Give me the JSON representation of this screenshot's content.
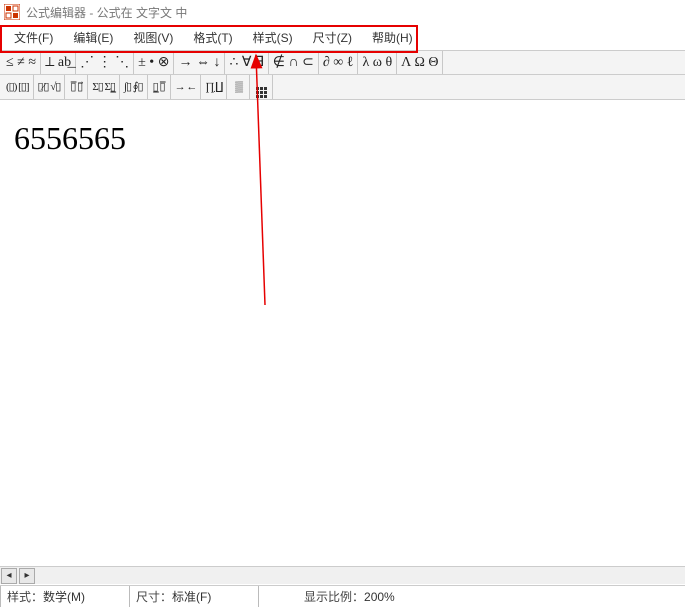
{
  "window": {
    "title": "公式编辑器 - 公式在 文字文 中"
  },
  "menubar": {
    "items": [
      {
        "label": "文件(F)"
      },
      {
        "label": "编辑(E)"
      },
      {
        "label": "视图(V)"
      },
      {
        "label": "格式(T)"
      },
      {
        "label": "样式(S)"
      },
      {
        "label": "尺寸(Z)"
      },
      {
        "label": "帮助(H)"
      }
    ]
  },
  "toolbar1": {
    "groups": [
      {
        "buttons": [
          "≤ ≠ ≈"
        ]
      },
      {
        "buttons": [
          "⟂ ab͟"
        ]
      },
      {
        "buttons": [
          "⋰ ⋮ ⋱"
        ]
      },
      {
        "buttons": [
          "± • ⊗"
        ]
      },
      {
        "buttons": [
          "→ ⇔ ↓"
        ]
      },
      {
        "buttons": [
          "∴ ∀ ∃"
        ]
      },
      {
        "buttons": [
          "∉ ∩ ⊂"
        ]
      },
      {
        "buttons": [
          "∂ ∞ ℓ"
        ]
      },
      {
        "buttons": [
          "λ ω θ"
        ]
      },
      {
        "buttons": [
          "Λ Ω Θ"
        ]
      }
    ]
  },
  "toolbar2": {
    "groups": [
      {
        "buttons": [
          "(▯) [▯]"
        ]
      },
      {
        "buttons": [
          "▯⁄▯ √▯"
        ]
      },
      {
        "buttons": [
          "▯̅ ▯⃗"
        ]
      },
      {
        "buttons": [
          "Σ▯ Σ▯̲"
        ]
      },
      {
        "buttons": [
          "∫▯ ∮▯"
        ]
      },
      {
        "buttons": [
          "▯̲ ▯̅"
        ]
      },
      {
        "buttons": [
          "→ ←"
        ]
      },
      {
        "buttons": [
          "∏̣ ∐̣"
        ]
      },
      {
        "buttons": [
          "▒"
        ]
      },
      {
        "buttons": [
          "⠿⠿"
        ]
      }
    ]
  },
  "editor": {
    "content": "6556565"
  },
  "statusbar": {
    "style_label": "样式：",
    "style_value": "数学(M)",
    "size_label": "尺寸：",
    "size_value": "标准(F)",
    "zoom_label": "显示比例：",
    "zoom_value": "200%"
  }
}
